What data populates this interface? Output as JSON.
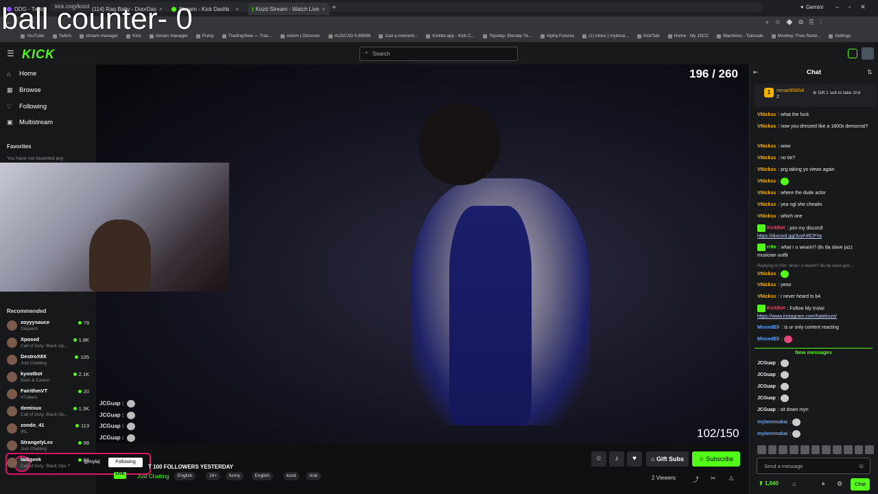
{
  "overlay_text": "ball counter- 0",
  "browser": {
    "tabs": [
      {
        "label": "DDG - Twitch",
        "color": "#9146ff"
      },
      {
        "label": "(114) Raq Baby - DoorDas",
        "color": "#ff0000"
      },
      {
        "label": "Stream - Kick Dashb",
        "color": "#53fc18"
      },
      {
        "label": "Kozd Stream - Watch Live",
        "color": "#53fc18"
      }
    ],
    "gemini": "Gemini",
    "url": "kick.com/kozd",
    "bookmarks": [
      "YouTube",
      "Twitch",
      "stream manager",
      "Kick",
      "stream manager",
      "Pump",
      "TradingView — Trac...",
      "Axiom | Discover",
      "AUDCAD 0.89596",
      "Just a moment...",
      "Kicklet.app - Kick C...",
      "Topstep: Elevate Yo...",
      "Alpha Futures",
      "(1) Inbox | mylenai...",
      "KickTalk",
      "Home - My JSCC",
      "Machines - Tailscale",
      "Monkey: Free Rand...",
      "Settings"
    ]
  },
  "kick": {
    "logo": "KICK",
    "search_placeholder": "Search",
    "nav": [
      {
        "label": "Home",
        "icon": "home-icon",
        "glyph": "⌂"
      },
      {
        "label": "Browse",
        "icon": "browse-icon",
        "glyph": "▦"
      },
      {
        "label": "Following",
        "icon": "heart-icon",
        "glyph": "♡"
      },
      {
        "label": "Multistream",
        "icon": "grid-icon",
        "glyph": "▣"
      }
    ],
    "favorites_title": "Favorites",
    "favorites_empty": "You have not favorited any",
    "recommended_title": "Recommended",
    "recommended": [
      {
        "name": "zoyyysauce",
        "category": "Dispatch",
        "viewers": "79"
      },
      {
        "name": "Xposed",
        "category": "Call of Duty: Black Op...",
        "viewers": "1.8K"
      },
      {
        "name": "DestroX8X",
        "category": "Just Chatting",
        "viewers": "105"
      },
      {
        "name": "kyootbot",
        "category": "Slots & Casino",
        "viewers": "2.1K"
      },
      {
        "name": "FairithmVT",
        "category": "VTubers",
        "viewers": "20"
      },
      {
        "name": "demisux",
        "category": "Call of Duty: Black Op...",
        "viewers": "1.3K"
      },
      {
        "name": "zondo_41",
        "category": "IRL",
        "viewers": "113"
      },
      {
        "name": "StrangelyLex",
        "category": "Just Chatting",
        "viewers": "98"
      },
      {
        "name": "ladigeek",
        "category": "Call of Duty: Black Ops 7",
        "viewers": "62"
      }
    ]
  },
  "video": {
    "counter_top": "196 / 260",
    "counter_bottom": "102/150",
    "jc_lines": [
      "JCGuap :",
      "JCGuap :",
      "JCGuap :",
      "JCGuap :"
    ]
  },
  "stream": {
    "handle": "@myla|",
    "following_label": "Following",
    "title": "T 100 FOLLOWERS YESTERDAY",
    "live": "LIVE",
    "category": "Just Chatting",
    "tags": [
      "English",
      "18+",
      "funny",
      "English",
      "kozd",
      "viral"
    ],
    "gift_subs": "Gift Subs",
    "subscribe": "Subscribe",
    "viewers": "2 Viewers"
  },
  "chat": {
    "title": "Chat",
    "pinned": {
      "user": "renae90654",
      "count": "2",
      "gift_text": "Gift 1 sub to take 2nd"
    },
    "messages": [
      {
        "user": "VNickss",
        "color": "#f5b400",
        "text": "what the fuck"
      },
      {
        "user": "VNickss",
        "color": "#f5b400",
        "text": "now you dressed like a 1800s democrat?"
      },
      {
        "user": "VNickss",
        "color": "#f5b400",
        "text": "wow"
      },
      {
        "user": "VNickss",
        "color": "#f5b400",
        "text": "no tie?"
      },
      {
        "user": "VNickss",
        "color": "#f5b400",
        "text": "prg taking yo views again"
      },
      {
        "user": "VNickss",
        "color": "#f5b400",
        "text": ""
      },
      {
        "user": "VNickss",
        "color": "#f5b400",
        "text": "where the dude actor"
      },
      {
        "user": "VNickss",
        "color": "#f5b400",
        "text": "yea ngl she cheatin"
      },
      {
        "user": "VNickss",
        "color": "#f5b400",
        "text": "which one"
      },
      {
        "user": "KickBot",
        "color": "#ff3b6b",
        "text": "join my discord!",
        "link": "https://discord.gg/3vyF4fCPYa"
      },
      {
        "user": "rr0n",
        "color": "#53fc18",
        "text": "what r u wearin? dis da slave jazz musician outfit"
      },
      {
        "user": "VNickss",
        "color": "#f5b400",
        "text": ""
      },
      {
        "user": "VNickss",
        "color": "#f5b400",
        "text": "yeoo"
      },
      {
        "user": "VNickss",
        "color": "#f5b400",
        "text": "i never heard ts b4"
      },
      {
        "user": "KickBot",
        "color": "#ff3b6b",
        "text": "Follow My Insta!",
        "link": "https://www.instagram.com/hatekoze/"
      },
      {
        "user": "MissedEli",
        "color": "#5ea6ff",
        "text": "is ur only content reacting"
      },
      {
        "user": "MissedEli",
        "color": "#5ea6ff",
        "text": ""
      }
    ],
    "reply_hint": "Replying to rr0n: what r u wearin? dis da slave jazz...",
    "new_messages": "New messages",
    "new": [
      {
        "user": "JCGuap",
        "color": "#eeeeee",
        "text": ""
      },
      {
        "user": "JCGuap",
        "color": "#eeeeee",
        "text": ""
      },
      {
        "user": "JCGuap",
        "color": "#eeeeee",
        "text": ""
      },
      {
        "user": "JCGuap",
        "color": "#eeeeee",
        "text": ""
      },
      {
        "user": "JCGuap",
        "color": "#eeeeee",
        "text": "sit down myn"
      },
      {
        "user": "mylannmakai",
        "color": "#5ea6ff",
        "text": ""
      },
      {
        "user": "mylannmakai",
        "color": "#5ea6ff",
        "text": ""
      }
    ],
    "input_placeholder": "Send a message",
    "points": "1,040",
    "chat_button": "Chat"
  }
}
